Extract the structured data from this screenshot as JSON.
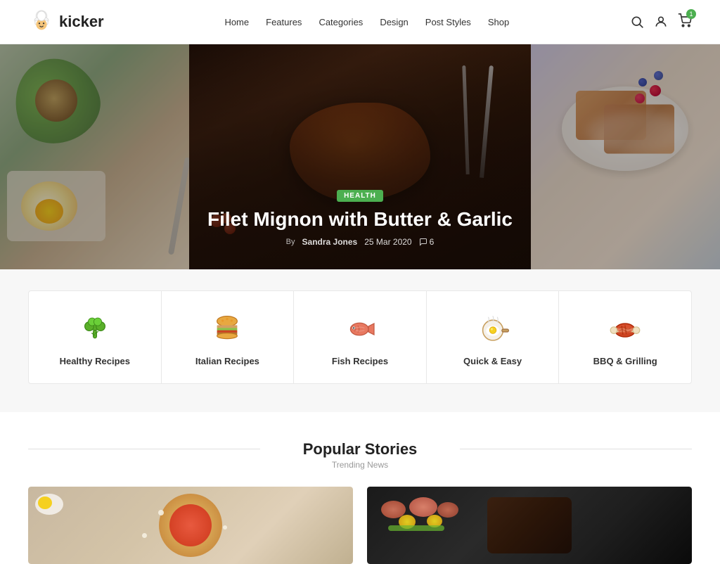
{
  "site": {
    "logo_text": "kicker",
    "cart_count": "1"
  },
  "nav": {
    "items": [
      {
        "label": "Home",
        "href": "#"
      },
      {
        "label": "Features",
        "href": "#"
      },
      {
        "label": "Categories",
        "href": "#"
      },
      {
        "label": "Design",
        "href": "#"
      },
      {
        "label": "Post Styles",
        "href": "#"
      },
      {
        "label": "Shop",
        "href": "#"
      }
    ]
  },
  "hero": {
    "badge": "HEALTH",
    "title": "Filet Mignon with Butter & Garlic",
    "author": "Sandra Jones",
    "date": "25 Mar 2020",
    "comments": "6"
  },
  "categories": {
    "items": [
      {
        "id": "healthy",
        "label": "Healthy Recipes",
        "icon": "🥦"
      },
      {
        "id": "italian",
        "label": "Italian Recipes",
        "icon": "🍔"
      },
      {
        "id": "fish",
        "label": "Fish Recipes",
        "icon": "🐟"
      },
      {
        "id": "quick",
        "label": "Quick & Easy",
        "icon": "🍳"
      },
      {
        "id": "bbq",
        "label": "BBQ & Grilling",
        "icon": "🍖"
      }
    ]
  },
  "popular": {
    "title": "Popular Stories",
    "subtitle": "Trending News"
  }
}
